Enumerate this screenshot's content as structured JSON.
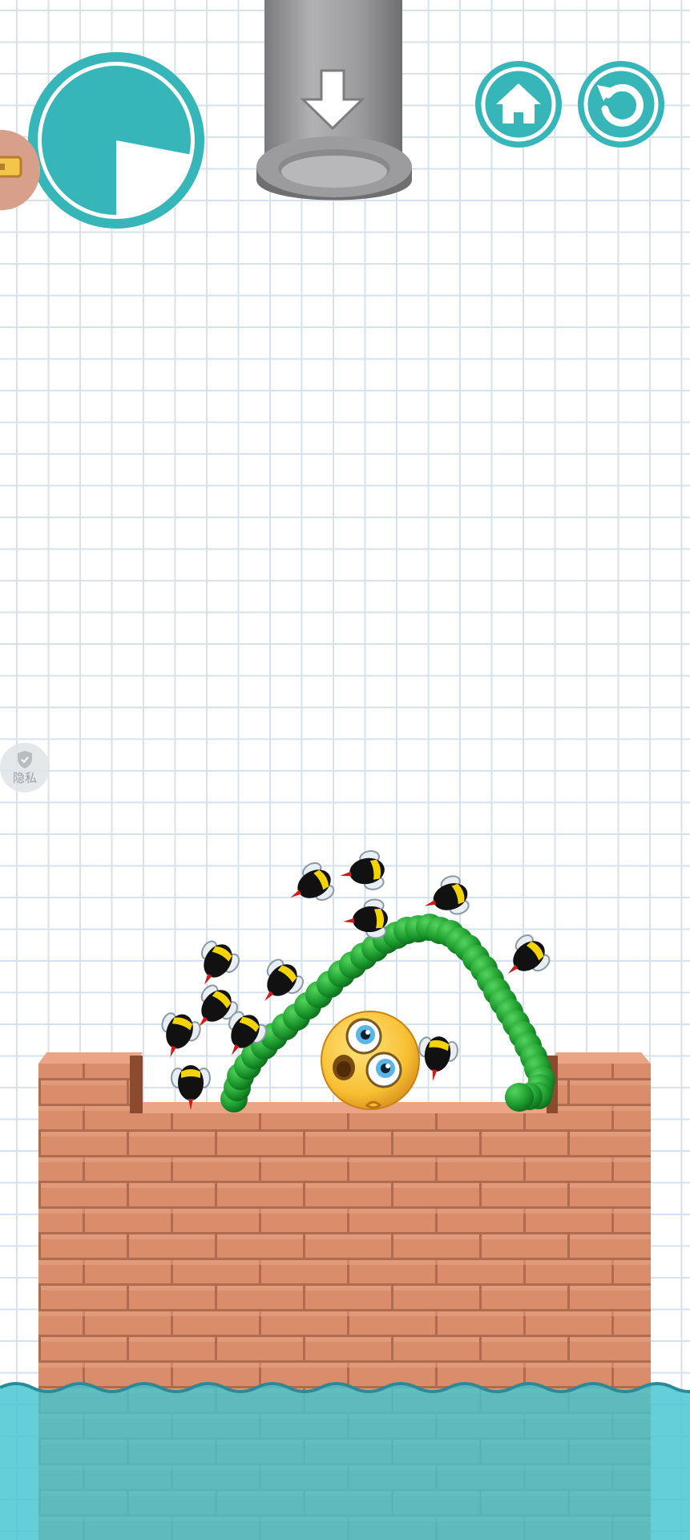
{
  "game": {
    "timer": {
      "remaining_fraction": 0.78,
      "color": "#36b6b8"
    },
    "buttons": {
      "home": "home-icon",
      "restart": "restart-icon"
    },
    "spawner": {
      "icon": "arrow-down-icon"
    },
    "privacy_badge": {
      "label": "隐私"
    },
    "characters": {
      "emoji": "scared-emoji",
      "bees": 12,
      "drawn_line": "green-bead-line"
    },
    "colors": {
      "brick": "#d98d6b",
      "mortar": "#b06a4c",
      "water": "#55c9d6",
      "line": "#22a838",
      "accent": "#36b6b8"
    }
  }
}
